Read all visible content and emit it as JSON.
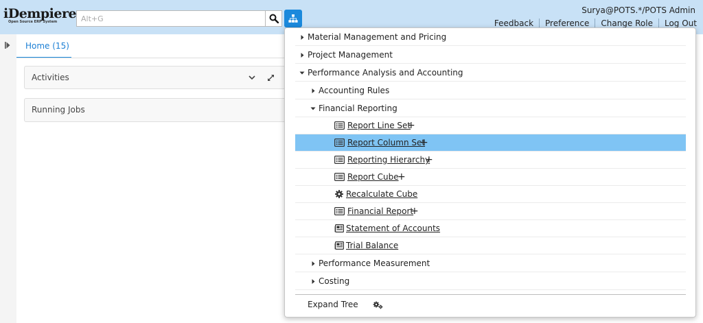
{
  "header": {
    "logo_text": "iDempiere",
    "logo_subtext": "Open Source ERP System",
    "search_placeholder": "Alt+G",
    "user": "Surya@POTS.*/POTS Admin",
    "links": [
      "Feedback",
      "Preference",
      "Change Role",
      "Log Out"
    ],
    "accent_color": "#1b89dc",
    "header_bg": "#c8e1f6"
  },
  "tabs": {
    "home_label": "Home (15)"
  },
  "panels": {
    "activities": "Activities",
    "running_jobs": "Running Jobs"
  },
  "menu": {
    "items": [
      {
        "label": "Material Management and Pricing",
        "level": 0,
        "kind": "folder",
        "expanded": false
      },
      {
        "label": "Project Management",
        "level": 0,
        "kind": "folder",
        "expanded": false
      },
      {
        "label": "Performance Analysis and Accounting",
        "level": 0,
        "kind": "folder",
        "expanded": true
      },
      {
        "label": "Accounting Rules",
        "level": 1,
        "kind": "folder",
        "expanded": false
      },
      {
        "label": "Financial Reporting",
        "level": 1,
        "kind": "folder",
        "expanded": true
      },
      {
        "label": "Report Line Set",
        "level": 2,
        "kind": "window",
        "plus": "+"
      },
      {
        "label": "Report Column Set",
        "level": 2,
        "kind": "window",
        "plus": "+",
        "selected": true
      },
      {
        "label": "Reporting Hierarchy",
        "level": 2,
        "kind": "window",
        "plus": "+"
      },
      {
        "label": "Report Cube",
        "level": 2,
        "kind": "window",
        "plus": "+"
      },
      {
        "label": "Recalculate Cube",
        "level": 2,
        "kind": "process"
      },
      {
        "label": "Financial Report",
        "level": 2,
        "kind": "window",
        "plus": "+"
      },
      {
        "label": "Statement of Accounts",
        "level": 2,
        "kind": "report"
      },
      {
        "label": "Trial Balance",
        "level": 2,
        "kind": "report"
      },
      {
        "label": "Performance Measurement",
        "level": 1,
        "kind": "folder",
        "expanded": false
      },
      {
        "label": "Costing",
        "level": 1,
        "kind": "folder",
        "expanded": false
      }
    ],
    "expand_tree_label": "Expand Tree",
    "selected_color": "#7fc4f4"
  }
}
